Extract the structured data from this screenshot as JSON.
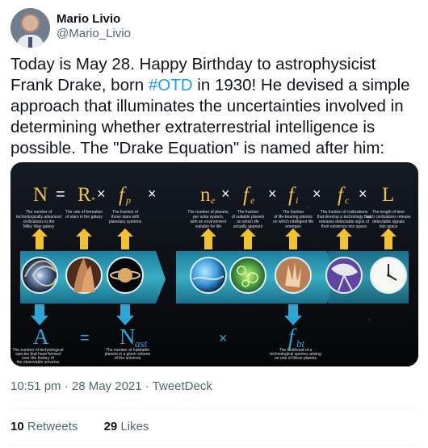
{
  "author": {
    "name": "Mario Livio",
    "handle": "@Mario_Livio"
  },
  "tweet": {
    "text_before": "Today is May 28. Happy Birthday to astrophysicist Frank Drake, born ",
    "hashtag": "#OTD",
    "text_after": " in 1930! He devised a simple approach that illuminates the uncertainties involved in determining whether extraterrestrial intelligence is possible. The \"Drake Equation\" is named after him:",
    "timestamp": "10:51 pm · 28 May 2021 · TweetDeck"
  },
  "stats": {
    "retweets_count": "10",
    "retweets_label": " Retweets",
    "likes_count": "29",
    "likes_label": " Likes"
  },
  "media": {
    "top_equation": {
      "N": "N",
      "eq": "=",
      "R": "R",
      "R_star": "*",
      "fp_f": "f",
      "fp_sub": "p",
      "ne_n": "n",
      "ne_sub": "e",
      "fe_f": "f",
      "fe_sub": "e",
      "fi_f": "f",
      "fi_sub": "i",
      "fc_f": "f",
      "fc_sub": "c",
      "L": "L",
      "times": "×"
    },
    "top_labels": {
      "N": [
        "The number of",
        "technologically advanced",
        "civilizations in the",
        "Milky Way galaxy"
      ],
      "R": [
        "The rate of formation",
        "of stars in the galaxy"
      ],
      "fp": [
        "The fraction of",
        "those stars with",
        "planetary systems"
      ],
      "ne": [
        "The number of planets,",
        "per solar system,",
        "with an environment",
        "suitable for life"
      ],
      "fe": [
        "The fraction",
        "of suitable planets",
        "on which life",
        "actually appears"
      ],
      "fi": [
        "The fraction",
        "of life-bearing planets",
        "on which intelligent life",
        "emerges"
      ],
      "fc": [
        "The fraction of civilizations",
        "that develop a technology that",
        "releases detectable signs of",
        "their existence into space"
      ],
      "L": [
        "The length of time",
        "such civilizations release",
        "detectable signals",
        "into space"
      ]
    },
    "bottom_equation": {
      "A": "A",
      "eq": "=",
      "N": "N",
      "N_sub": "ast",
      "times": "×",
      "f": "f",
      "f_sub": "bt"
    },
    "bottom_labels": {
      "A": [
        "The number of technological",
        "species that have formed",
        "over the history of",
        "the observable universe"
      ],
      "N": [
        "The number of habitable",
        "planets in a given volume",
        "of the universe"
      ],
      "f": [
        "The likelihood of a",
        "technological species arising",
        "on one of these planets"
      ]
    },
    "colors": {
      "gold": "#f0c24b",
      "blue": "#2ba7d6",
      "band": "#35a6ba"
    }
  }
}
